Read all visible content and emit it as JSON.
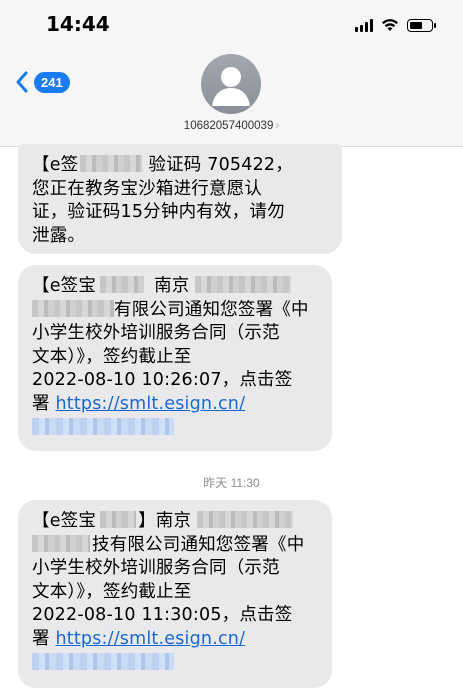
{
  "status_bar": {
    "time": "14:44"
  },
  "header": {
    "unread_count": "241",
    "contact_number": "10682057400039",
    "contact_chevron": "›"
  },
  "messages": [
    {
      "lines": [
        [
          "【e签",
          "",
          "验证码 705422，"
        ],
        [
          "您正在教务宝沙箱进行意愿认"
        ],
        [
          "证，验证码15分钟内有效，请勿"
        ],
        [
          "泄露。"
        ]
      ]
    },
    {
      "lines": [
        [
          "【e签宝",
          "",
          "南京"
        ],
        [
          "",
          "有限公司通知您签署《中"
        ],
        [
          "小学生校外培训服务合同（示范"
        ],
        [
          "文本）》，签约截止至"
        ],
        [
          "2022-08-10 10:26:07，点击签"
        ]
      ],
      "link_prefix": "署 ",
      "link": "https://smlt.esign.cn/"
    },
    {
      "lines": [
        [
          "【e签宝",
          "",
          "】南京"
        ],
        [
          "",
          "技有限公司通知您签署《中"
        ],
        [
          "小学生校外培训服务合同（示范"
        ],
        [
          "文本）》，签约截止至"
        ],
        [
          "2022-08-10 11:30:05，点击签"
        ]
      ],
      "link_prefix": "署 ",
      "link": "https://smlt.esign.cn/"
    }
  ],
  "timestamp": "昨天 11:30",
  "colors": {
    "accent": "#1a7cf5",
    "bubble": "#e9e9eb",
    "link": "#1768d4"
  },
  "icons": [
    "cellular-signal-icon",
    "wifi-icon",
    "battery-icon",
    "back-chevron-icon",
    "contact-avatar-icon"
  ]
}
